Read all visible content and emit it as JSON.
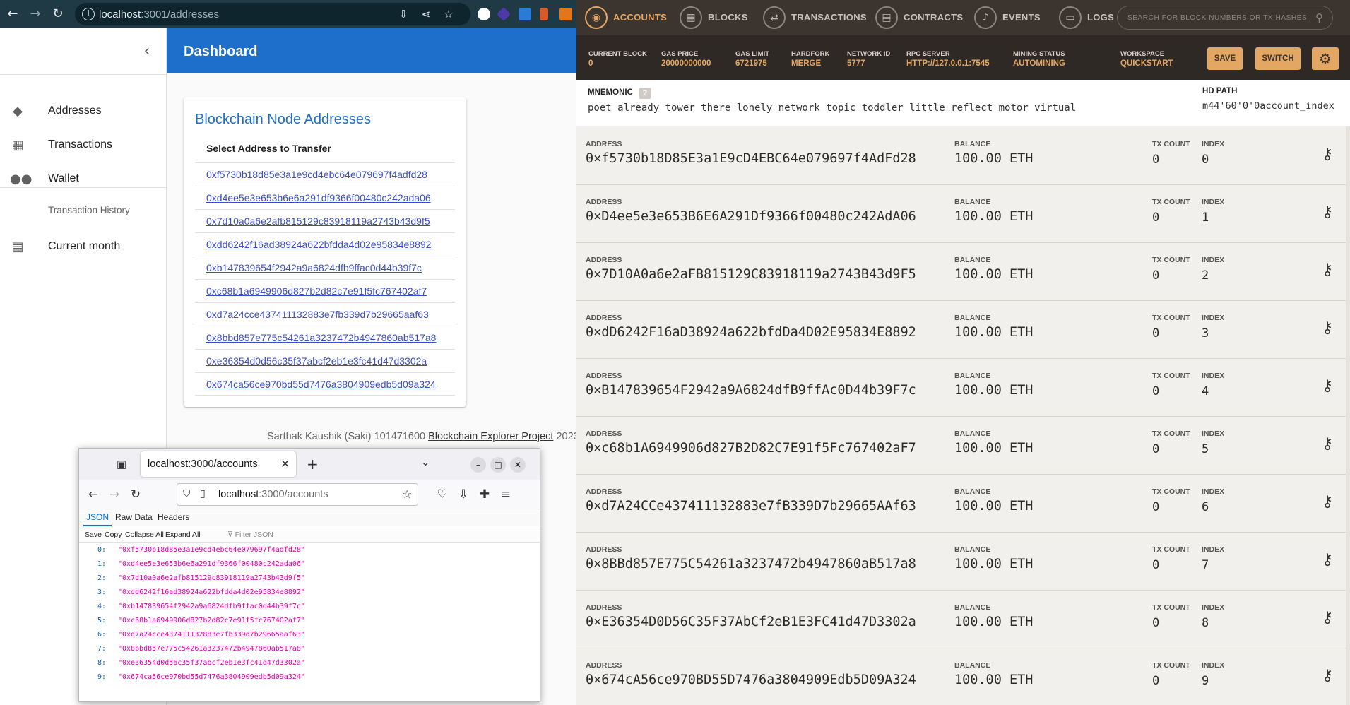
{
  "chrome": {
    "url_host": "localhost",
    "url_path": ":3001/addresses",
    "icons": {
      "back": "arrow-left-icon",
      "forward": "arrow-right-icon",
      "reload": "reload-icon",
      "install": "install-app-icon",
      "share": "share-icon",
      "bookmark": "star-icon"
    }
  },
  "dashboard": {
    "app_title": "Dashboard",
    "sidebar": {
      "items": [
        {
          "label": "Addresses",
          "icon": "layers-icon"
        },
        {
          "label": "Transactions",
          "icon": "dashboard-icon"
        },
        {
          "label": "Wallet",
          "icon": "people-icon"
        }
      ],
      "section_label": "Transaction History",
      "sub_items": [
        {
          "label": "Current month",
          "icon": "clipboard-icon"
        }
      ]
    },
    "card": {
      "title": "Blockchain Node Addresses",
      "subtitle": "Select Address to Transfer",
      "addresses": [
        "0xf5730b18d85e3a1e9cd4ebc64e079697f4adfd28",
        "0xd4ee5e3e653b6e6a291df9366f00480c242ada06",
        "0x7d10a0a6e2afb815129c83918119a2743b43d9f5",
        "0xdd6242f16ad38924a622bfdda4d02e95834e8892",
        "0xb147839654f2942a9a6824dfb9ffac0d44b39f7c",
        "0xc68b1a6949906d827b2d82c7e91f5fc767402af7",
        "0xd7a24cce437411132883e7fb339d7b29665aaf63",
        "0x8bbd857e775c54261a3237472b4947860ab517a8",
        "0xe36354d0d56c35f37abcf2eb1e3fc41d47d3302a",
        "0x674ca56ce970bd55d7476a3804909edb5d09a324"
      ]
    },
    "footer": {
      "text": "Sarthak Kaushik (Saki) 101471600 ",
      "link": "Blockchain Explorer Project",
      "year": " 2023."
    }
  },
  "firefox": {
    "tab_title": "localhost:3000/accounts",
    "url_host": "localhost",
    "url_path": ":3000/accounts",
    "view_tabs": [
      "JSON",
      "Raw Data",
      "Headers"
    ],
    "toolbar": [
      "Save",
      "Copy",
      "Collapse All",
      "Expand All"
    ],
    "filter_placeholder": "Filter JSON",
    "json": [
      {
        "key": "0:",
        "value": "\"0xf5730b18d85e3a1e9cd4ebc64e079697f4adfd28\""
      },
      {
        "key": "1:",
        "value": "\"0xd4ee5e3e653b6e6a291df9366f00480c242ada06\""
      },
      {
        "key": "2:",
        "value": "\"0x7d10a0a6e2afb815129c83918119a2743b43d9f5\""
      },
      {
        "key": "3:",
        "value": "\"0xdd6242f16ad38924a622bfdda4d02e95834e8892\""
      },
      {
        "key": "4:",
        "value": "\"0xb147839654f2942a9a6824dfb9ffac0d44b39f7c\""
      },
      {
        "key": "5:",
        "value": "\"0xc68b1a6949906d827b2d82c7e91f5fc767402af7\""
      },
      {
        "key": "6:",
        "value": "\"0xd7a24cce437411132883e7fb339d7b29665aaf63\""
      },
      {
        "key": "7:",
        "value": "\"0x8bbd857e775c54261a3237472b4947860ab517a8\""
      },
      {
        "key": "8:",
        "value": "\"0xe36354d0d56c35f37abcf2eb1e3fc41d47d3302a\""
      },
      {
        "key": "9:",
        "value": "\"0x674ca56ce970bd55d7476a3804909edb5d09a324\""
      }
    ]
  },
  "ganache": {
    "nav": [
      {
        "label": "ACCOUNTS",
        "icon": "account-icon",
        "active": true
      },
      {
        "label": "BLOCKS",
        "icon": "blocks-icon",
        "active": false
      },
      {
        "label": "TRANSACTIONS",
        "icon": "transactions-icon",
        "active": false
      },
      {
        "label": "CONTRACTS",
        "icon": "contracts-icon",
        "active": false
      },
      {
        "label": "EVENTS",
        "icon": "bell-icon",
        "active": false
      },
      {
        "label": "LOGS",
        "icon": "logs-icon",
        "active": false
      }
    ],
    "search_placeholder": "SEARCH FOR BLOCK NUMBERS OR TX HASHES",
    "status": [
      {
        "label": "CURRENT BLOCK",
        "value": "0"
      },
      {
        "label": "GAS PRICE",
        "value": "20000000000"
      },
      {
        "label": "GAS LIMIT",
        "value": "6721975"
      },
      {
        "label": "HARDFORK",
        "value": "MERGE"
      },
      {
        "label": "NETWORK ID",
        "value": "5777"
      },
      {
        "label": "RPC SERVER",
        "value": "HTTP://127.0.0.1:7545"
      },
      {
        "label": "MINING STATUS",
        "value": "AUTOMINING"
      },
      {
        "label": "WORKSPACE",
        "value": "QUICKSTART"
      }
    ],
    "save_label": "SAVE",
    "switch_label": "SWITCH",
    "mnemonic_label": "MNEMONIC",
    "mnemonic_help": "?",
    "mnemonic": "poet already tower there lonely network topic toddler little reflect motor virtual",
    "hd_path_label": "HD PATH",
    "hd_path": "m44'60'0'0account_index",
    "col_labels": {
      "address": "ADDRESS",
      "balance": "BALANCE",
      "tx_count": "TX COUNT",
      "index": "INDEX"
    },
    "accounts": [
      {
        "address": "0×f5730b18D85E3a1E9cD4EBC64e079697f4AdFd28",
        "balance": "100.00 ETH",
        "tx_count": "0",
        "index": "0"
      },
      {
        "address": "0×D4ee5e3e653B6E6A291Df9366f00480c242AdA06",
        "balance": "100.00 ETH",
        "tx_count": "0",
        "index": "1"
      },
      {
        "address": "0×7D10A0a6e2aFB815129C83918119a2743B43d9F5",
        "balance": "100.00 ETH",
        "tx_count": "0",
        "index": "2"
      },
      {
        "address": "0×dD6242F16aD38924a622bfdDa4D02E95834E8892",
        "balance": "100.00 ETH",
        "tx_count": "0",
        "index": "3"
      },
      {
        "address": "0×B147839654F2942a9A6824dfB9ffAc0D44b39F7c",
        "balance": "100.00 ETH",
        "tx_count": "0",
        "index": "4"
      },
      {
        "address": "0×c68b1A6949906d827B2D82C7E91f5Fc767402aF7",
        "balance": "100.00 ETH",
        "tx_count": "0",
        "index": "5"
      },
      {
        "address": "0×d7A24CCe437411132883e7fB339D7b29665AAf63",
        "balance": "100.00 ETH",
        "tx_count": "0",
        "index": "6"
      },
      {
        "address": "0×8BBd857E775C54261a3237472b4947860aB517a8",
        "balance": "100.00 ETH",
        "tx_count": "0",
        "index": "7"
      },
      {
        "address": "0×E36354D0D56C35F37AbCf2eB1E3FC41d47D3302a",
        "balance": "100.00 ETH",
        "tx_count": "0",
        "index": "8"
      },
      {
        "address": "0×674cA56ce970BD55D7476a3804909Edb5D09A324",
        "balance": "100.00 ETH",
        "tx_count": "0",
        "index": "9"
      }
    ],
    "colors": {
      "accent": "#e4a663",
      "nav_bg": "#3b342f"
    }
  }
}
